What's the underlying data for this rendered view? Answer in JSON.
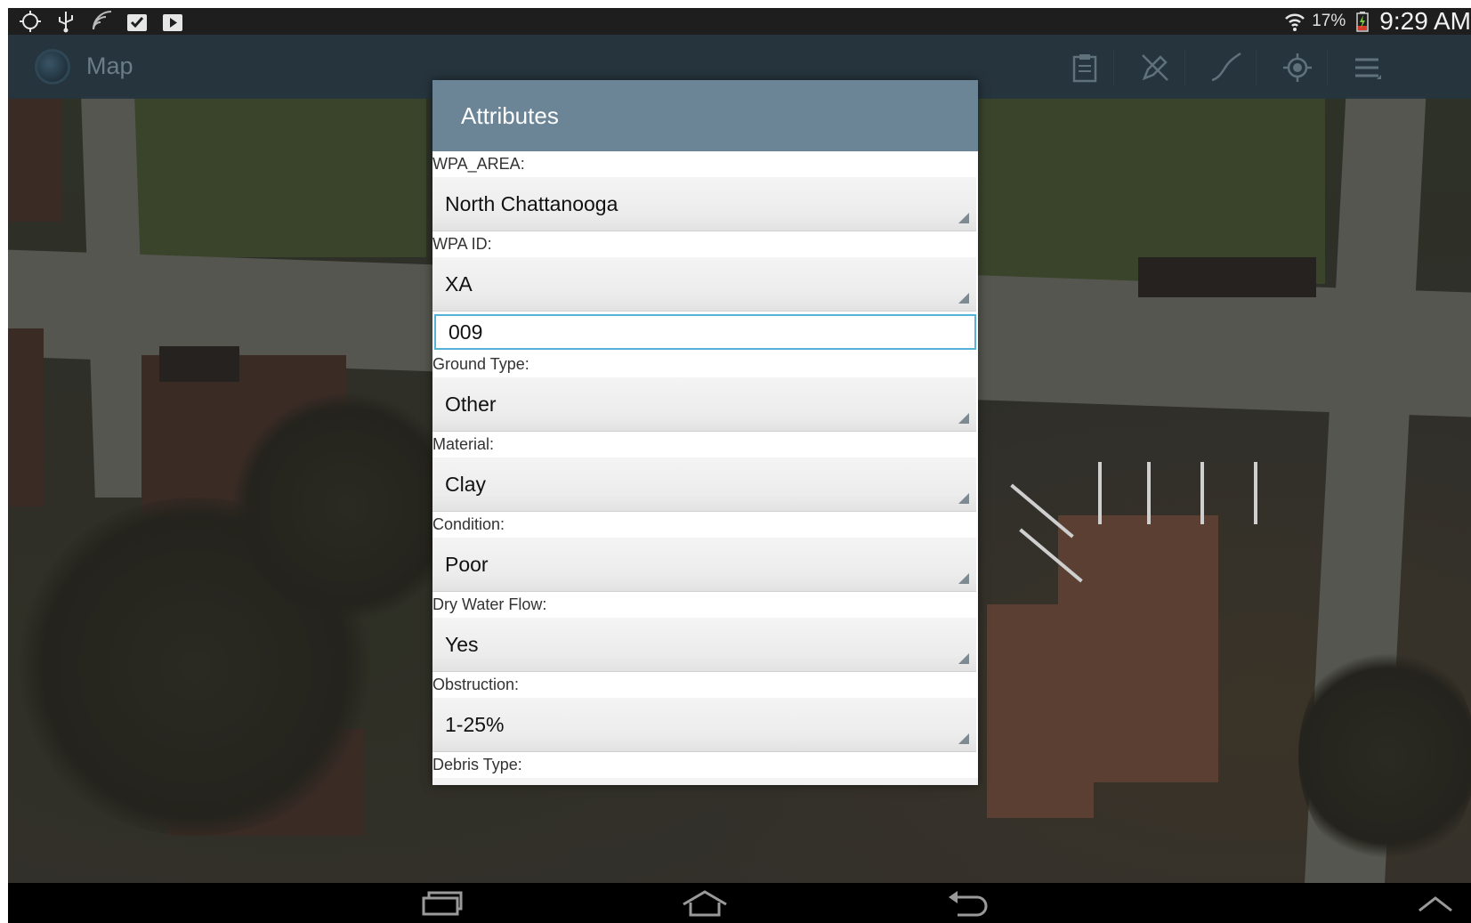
{
  "status_bar": {
    "battery_percent": "17%",
    "time": "9:29 AM"
  },
  "action_bar": {
    "title": "Map"
  },
  "dialog": {
    "title": "Attributes",
    "fields": [
      {
        "label": "WPA_AREA:",
        "value": "North Chattanooga"
      },
      {
        "label": "WPA ID:",
        "value": "XA",
        "input_value": "009"
      },
      {
        "label": "Ground Type:",
        "value": "Other"
      },
      {
        "label": "Material:",
        "value": "Clay"
      },
      {
        "label": "Condition:",
        "value": "Poor"
      },
      {
        "label": "Dry Water Flow:",
        "value": "Yes"
      },
      {
        "label": "Obstruction:",
        "value": "1-25%"
      },
      {
        "label": "Debris Type:"
      }
    ]
  },
  "colors": {
    "dialog_header": "#6b8596",
    "action_bar": "#26343f",
    "input_focus": "#55b3d8"
  }
}
